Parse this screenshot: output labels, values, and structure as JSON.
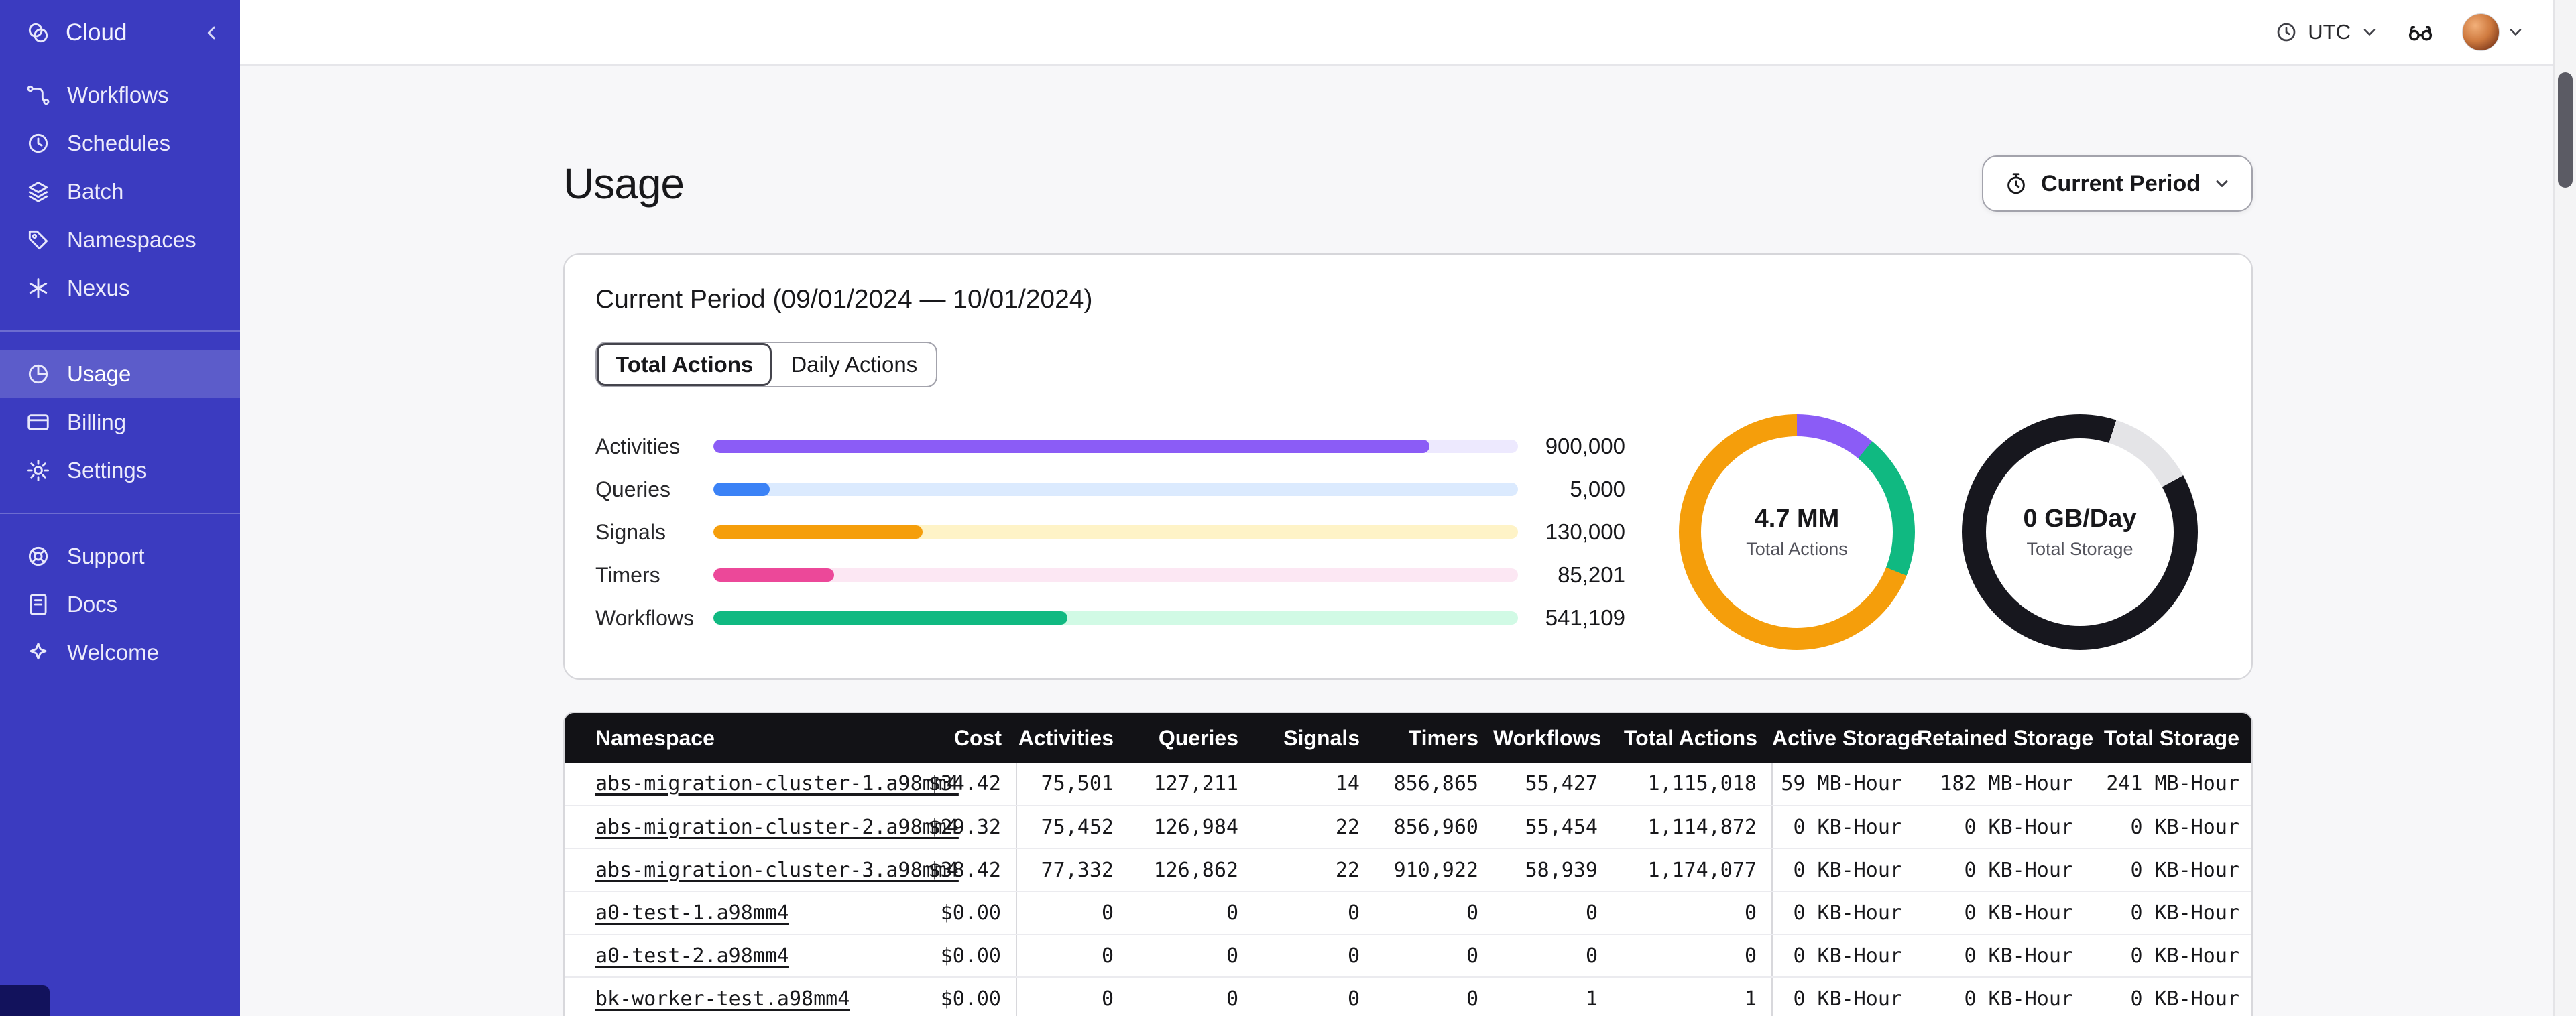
{
  "sidebar": {
    "header": {
      "label": "Cloud"
    },
    "groups": [
      {
        "items": [
          {
            "label": "Workflows",
            "icon": "workflows-icon"
          },
          {
            "label": "Schedules",
            "icon": "schedules-icon"
          },
          {
            "label": "Batch",
            "icon": "batch-icon"
          },
          {
            "label": "Namespaces",
            "icon": "namespaces-icon"
          },
          {
            "label": "Nexus",
            "icon": "nexus-icon"
          }
        ]
      },
      {
        "items": [
          {
            "label": "Usage",
            "icon": "usage-icon",
            "selected": true
          },
          {
            "label": "Billing",
            "icon": "billing-icon"
          },
          {
            "label": "Settings",
            "icon": "settings-icon"
          }
        ]
      },
      {
        "items": [
          {
            "label": "Support",
            "icon": "support-icon"
          },
          {
            "label": "Docs",
            "icon": "docs-icon"
          },
          {
            "label": "Welcome",
            "icon": "welcome-icon"
          }
        ]
      }
    ]
  },
  "topbar": {
    "timezone": "UTC"
  },
  "page": {
    "title": "Usage",
    "period_selector": "Current Period"
  },
  "usage_card": {
    "title": "Current Period (09/01/2024 — 10/01/2024)",
    "tabs": [
      {
        "label": "Total Actions",
        "selected": true
      },
      {
        "label": "Daily Actions",
        "selected": false
      }
    ],
    "chart_data": {
      "type": "bar",
      "categories": [
        "Activities",
        "Queries",
        "Signals",
        "Timers",
        "Workflows"
      ],
      "values": [
        900000,
        5000,
        130000,
        85201,
        541109
      ]
    },
    "bars": [
      {
        "label": "Activities",
        "value": "900,000",
        "pct": 89,
        "color": "#8b5cf6",
        "track_color": "#ede9fe"
      },
      {
        "label": "Queries",
        "value": "5,000",
        "pct": 7,
        "color": "#3b82f6",
        "track_color": "#dbeafe"
      },
      {
        "label": "Signals",
        "value": "130,000",
        "pct": 26,
        "color": "#f59e0b",
        "track_color": "#fef3c7"
      },
      {
        "label": "Timers",
        "value": "85,201",
        "pct": 15,
        "color": "#ec4899",
        "track_color": "#fce7f3"
      },
      {
        "label": "Workflows",
        "value": "541,109",
        "pct": 44,
        "color": "#10b981",
        "track_color": "#d1fae5"
      }
    ],
    "donuts": [
      {
        "value": "4.7 MM",
        "label": "Total Actions",
        "thickness": 33,
        "segments": [
          {
            "color": "#8b5cf6",
            "pct": 11
          },
          {
            "color": "#10b981",
            "pct": 20
          },
          {
            "color": "#f59e0b",
            "pct": 69
          }
        ]
      },
      {
        "value": "0 GB/Day",
        "label": "Total Storage",
        "thickness": 36,
        "segments": [
          {
            "color": "#17171e",
            "pct": 5
          },
          {
            "color": "#e4e4e7",
            "pct": 12
          },
          {
            "color": "#17171e",
            "pct": 83
          }
        ]
      }
    ]
  },
  "table": {
    "columns": [
      "Namespace",
      "Cost",
      "Activities",
      "Queries",
      "Signals",
      "Timers",
      "Workflows",
      "Total Actions",
      "Active Storage",
      "Retained Storage",
      "Total Storage"
    ],
    "rows": [
      [
        "abs-migration-cluster-1.a98mm4",
        "$34.42",
        "75,501",
        "127,211",
        "14",
        "856,865",
        "55,427",
        "1,115,018",
        "59 MB-Hour",
        "182 MB-Hour",
        "241 MB-Hour"
      ],
      [
        "abs-migration-cluster-2.a98mm4",
        "$29.32",
        "75,452",
        "126,984",
        "22",
        "856,960",
        "55,454",
        "1,114,872",
        "0 KB-Hour",
        "0 KB-Hour",
        "0 KB-Hour"
      ],
      [
        "abs-migration-cluster-3.a98mm4",
        "$38.42",
        "77,332",
        "126,862",
        "22",
        "910,922",
        "58,939",
        "1,174,077",
        "0 KB-Hour",
        "0 KB-Hour",
        "0 KB-Hour"
      ],
      [
        "a0-test-1.a98mm4",
        "$0.00",
        "0",
        "0",
        "0",
        "0",
        "0",
        "0",
        "0 KB-Hour",
        "0 KB-Hour",
        "0 KB-Hour"
      ],
      [
        "a0-test-2.a98mm4",
        "$0.00",
        "0",
        "0",
        "0",
        "0",
        "0",
        "0",
        "0 KB-Hour",
        "0 KB-Hour",
        "0 KB-Hour"
      ],
      [
        "bk-worker-test.a98mm4",
        "$0.00",
        "0",
        "0",
        "0",
        "0",
        "1",
        "1",
        "0 KB-Hour",
        "0 KB-Hour",
        "0 KB-Hour"
      ]
    ]
  }
}
